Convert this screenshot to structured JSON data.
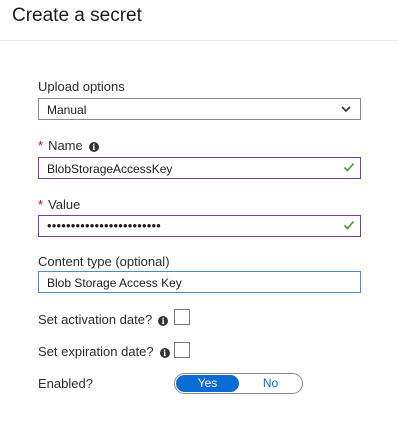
{
  "header": {
    "title": "Create a secret"
  },
  "form": {
    "upload_options": {
      "label": "Upload options",
      "value": "Manual"
    },
    "name": {
      "required_mark": "*",
      "label": "Name",
      "value": "BlobStorageAccessKey",
      "info_icon": "info-icon"
    },
    "value": {
      "required_mark": "*",
      "label": "Value",
      "masked_value": "••••••••••••••••••••••••"
    },
    "content_type": {
      "label": "Content type (optional)",
      "value": "Blob Storage Access Key"
    },
    "activation_date": {
      "label": "Set activation date?"
    },
    "expiration_date": {
      "label": "Set expiration date?"
    },
    "enabled": {
      "label": "Enabled?",
      "yes_label": "Yes",
      "no_label": "No",
      "selected": "Yes"
    }
  },
  "colors": {
    "required": "#c8001e",
    "valid_border": "#7d3c98",
    "focus_border": "#4a8bc9",
    "check": "#4f9a3f",
    "toggle_active": "#0b6cd6"
  },
  "icons": [
    "chevron-down-icon",
    "info-icon",
    "checkmark-icon"
  ]
}
